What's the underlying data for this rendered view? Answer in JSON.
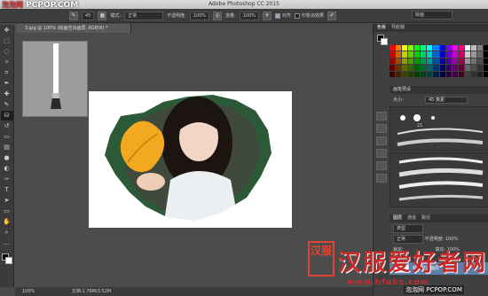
{
  "app": {
    "title": "Adobe Photoshop CC 2015"
  },
  "watermark_top": {
    "cn": "泡泡网",
    "site": "PCPOP.COM"
  },
  "options_bar": {
    "brush_size": "45",
    "mode_label": "模式:",
    "mode_value": "正常",
    "opacity_label": "不透明度:",
    "opacity_value": "100%",
    "flow_label": "流量:",
    "flow_value": "100%",
    "align_label": "对齐",
    "sample_label": "印象派效果",
    "workspace": "绘画"
  },
  "document": {
    "tab": "3.jpg @ 100% (绘画空白画层, RGB/8) *"
  },
  "status": {
    "zoom": "100%",
    "doc": "文档:1.76M/3.52M"
  },
  "panels": {
    "tabs": [
      "色板",
      "导航器"
    ],
    "brush_presets_title": "画笔预设",
    "size_label": "大小:",
    "size_value": "45 像素",
    "tip_number": "21",
    "layers_tabs": [
      "图层",
      "通道",
      "路径"
    ],
    "kind_label": "类型",
    "blend_mode": "正常",
    "opacity_label": "不透明度:",
    "opacity_value": "100%",
    "lock_label": "锁定:",
    "fill_label": "填充:",
    "fill_value": "100%",
    "layer_name": "绘画空白画层"
  },
  "watermark_bottom": {
    "seal": "汉服",
    "title": "汉服爱好者网",
    "url": "www.hfahz.com",
    "url2": "泡泡网 PCPOP.COM"
  },
  "colors": {
    "swatches": [
      "#ff0000",
      "#ff8000",
      "#ffff00",
      "#80ff00",
      "#00ff00",
      "#00ff80",
      "#00ffff",
      "#0080ff",
      "#0000ff",
      "#8000ff",
      "#ff00ff",
      "#ff0080",
      "#ffffff",
      "#c0c0c0",
      "#808080",
      "#000000"
    ]
  }
}
